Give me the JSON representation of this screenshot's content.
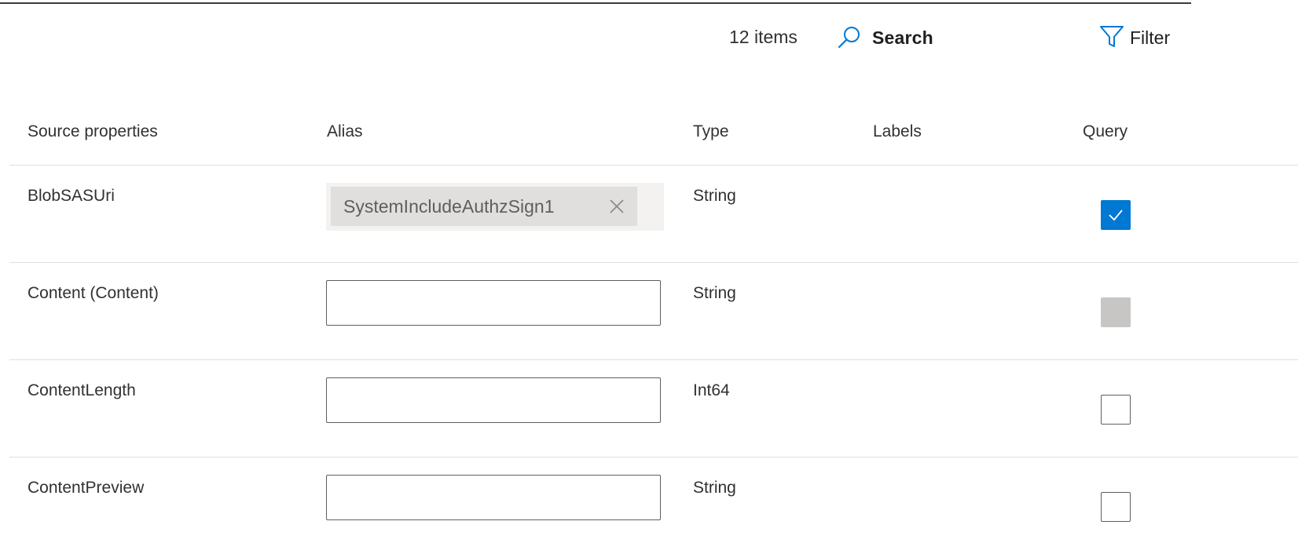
{
  "toolbar": {
    "count_text": "12 items",
    "search_label": "Search",
    "filter_label": "Filter",
    "accent_color": "#0078d4"
  },
  "columns": {
    "source": "Source properties",
    "alias": "Alias",
    "type": "Type",
    "labels": "Labels",
    "query": "Query"
  },
  "rows": [
    {
      "source": "BlobSASUri",
      "alias_tag": "SystemIncludeAuthzSign1",
      "type": "String",
      "query_state": "checked"
    },
    {
      "source": "Content (Content)",
      "alias_value": "",
      "type": "String",
      "query_state": "disabled"
    },
    {
      "source": "ContentLength",
      "alias_value": "",
      "type": "Int64",
      "query_state": "unchecked"
    },
    {
      "source": "ContentPreview",
      "alias_value": "",
      "type": "String",
      "query_state": "unchecked"
    }
  ],
  "icons": {
    "search": "search-icon",
    "filter": "filter-icon",
    "remove_tag": "close-icon",
    "check": "checkmark-icon"
  }
}
